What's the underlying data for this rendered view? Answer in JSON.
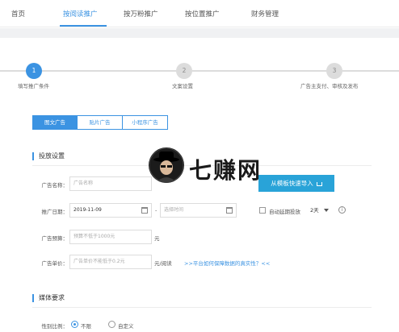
{
  "nav": {
    "items": [
      "首页",
      "按阅读推广",
      "按万粉推广",
      "按位置推广",
      "财务管理"
    ],
    "active_index": 1
  },
  "steps": [
    {
      "num": "1",
      "label": "填写推广条件"
    },
    {
      "num": "2",
      "label": "文案设置"
    },
    {
      "num": "3",
      "label": "广告主支付、审核及发布"
    }
  ],
  "current_step": 1,
  "tabs": [
    "图文广告",
    "贴片广告",
    "小程序广告"
  ],
  "active_tab": 0,
  "sections": {
    "placement": "投放设置",
    "media": "媒体要求"
  },
  "form": {
    "ad_name_label": "广告名称：",
    "ad_name_placeholder": "广告名称",
    "import_button": "从模板快速导入",
    "date_label": "推广日期：",
    "start_date": "2019-11-09",
    "date_separator": "-",
    "end_date_placeholder": "选择时间",
    "auto_extend_label": "自动延期投放",
    "extend_days": "2天",
    "budget_label": "广告预算：",
    "budget_placeholder": "预算不低于1000元",
    "budget_unit": "元",
    "price_label": "广告单价：",
    "price_placeholder": "广告单价不能低于0.2元",
    "price_unit": "元/阅读",
    "price_link": ">>平台如何保障数据的真实性？<<",
    "gender_label": "性别比例：",
    "gender_options": [
      "不限",
      "自定义"
    ],
    "gender_selected": 0
  },
  "watermark": {
    "text": "七赚网"
  },
  "colors": {
    "accent": "#3b93e2",
    "import_button": "#29a3d8"
  }
}
